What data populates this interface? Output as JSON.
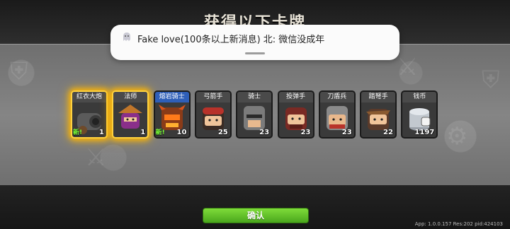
{
  "title": "获得以下卡牌",
  "notification": {
    "icon": "ghost-app-icon",
    "text": "Fake love(100条以上新消息) 北: 微信没成年"
  },
  "cards": [
    {
      "name": "红衣大炮",
      "count": "1",
      "new": "新!",
      "glow": "gold",
      "icon": "cannon-icon"
    },
    {
      "name": "法师",
      "count": "1",
      "new": "",
      "glow": "gold",
      "icon": "mage-icon"
    },
    {
      "name": "熔岩骑士",
      "count": "10",
      "new": "新!",
      "glow": "none",
      "icon": "lava-knight-icon"
    },
    {
      "name": "弓箭手",
      "count": "25",
      "new": "",
      "glow": "none",
      "icon": "archer-icon"
    },
    {
      "name": "骑士",
      "count": "23",
      "new": "",
      "glow": "none",
      "icon": "knight-icon"
    },
    {
      "name": "投弹手",
      "count": "23",
      "new": "",
      "glow": "none",
      "icon": "bomber-icon"
    },
    {
      "name": "刀盾兵",
      "count": "23",
      "new": "",
      "glow": "none",
      "icon": "shield-soldier-icon"
    },
    {
      "name": "踏弩手",
      "count": "22",
      "new": "",
      "glow": "none",
      "icon": "crossbowman-icon"
    },
    {
      "name": "钱币",
      "count": "1197",
      "new": "",
      "glow": "none",
      "icon": "coin-stack-icon"
    }
  ],
  "confirm_label": "确认",
  "version_info": "App: 1.0.0.157 Res:202 pid:424103",
  "colors": {
    "gold_glow": "#ffb400",
    "confirm_green": "#5ec12a",
    "new_green": "#7cff3a",
    "band_gray": "#7c7c7c"
  }
}
